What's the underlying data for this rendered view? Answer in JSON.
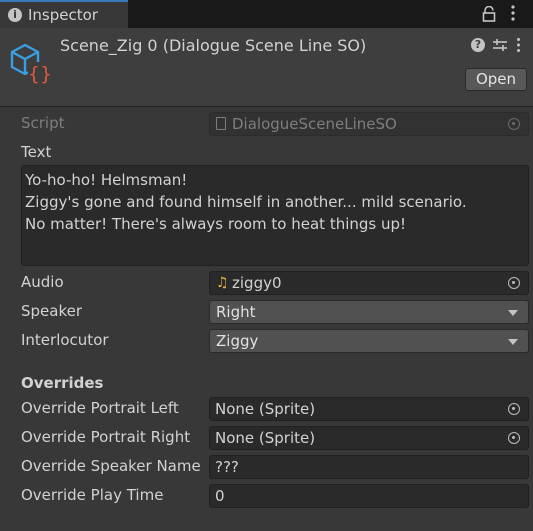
{
  "window": {
    "tab_label": "Inspector",
    "tab_icon_glyph": "i"
  },
  "header": {
    "asset_name": "Scene_Zig 0 (Dialogue Scene Line SO)",
    "open_label": "Open",
    "help_glyph": "?"
  },
  "fields": {
    "script": {
      "label": "Script",
      "value": "DialogueSceneLineSO"
    },
    "text": {
      "label": "Text",
      "value": "Yo-ho-ho! Helmsman!\nZiggy's gone and found himself in another... mild scenario.\nNo matter! There's always room to heat things up!"
    },
    "audio": {
      "label": "Audio",
      "value": "ziggy0",
      "icon": "audio-clip-icon"
    },
    "speaker": {
      "label": "Speaker",
      "value": "Right"
    },
    "interlocutor": {
      "label": "Interlocutor",
      "value": "Ziggy"
    }
  },
  "overrides": {
    "section_label": "Overrides",
    "portrait_left": {
      "label": "Override Portrait Left",
      "value": "None (Sprite)"
    },
    "portrait_right": {
      "label": "Override Portrait Right",
      "value": "None (Sprite)"
    },
    "speaker_name": {
      "label": "Override Speaker Name",
      "value": "???"
    },
    "play_time": {
      "label": "Override Play Time",
      "value": "0"
    }
  },
  "colors": {
    "background": "#383838",
    "field": "#2a2a2a",
    "dropdown": "#515151",
    "tab_accent": "#3a79bb",
    "so_icon_cube": "#3a9ee0",
    "so_icon_braces": "#e2583e"
  }
}
